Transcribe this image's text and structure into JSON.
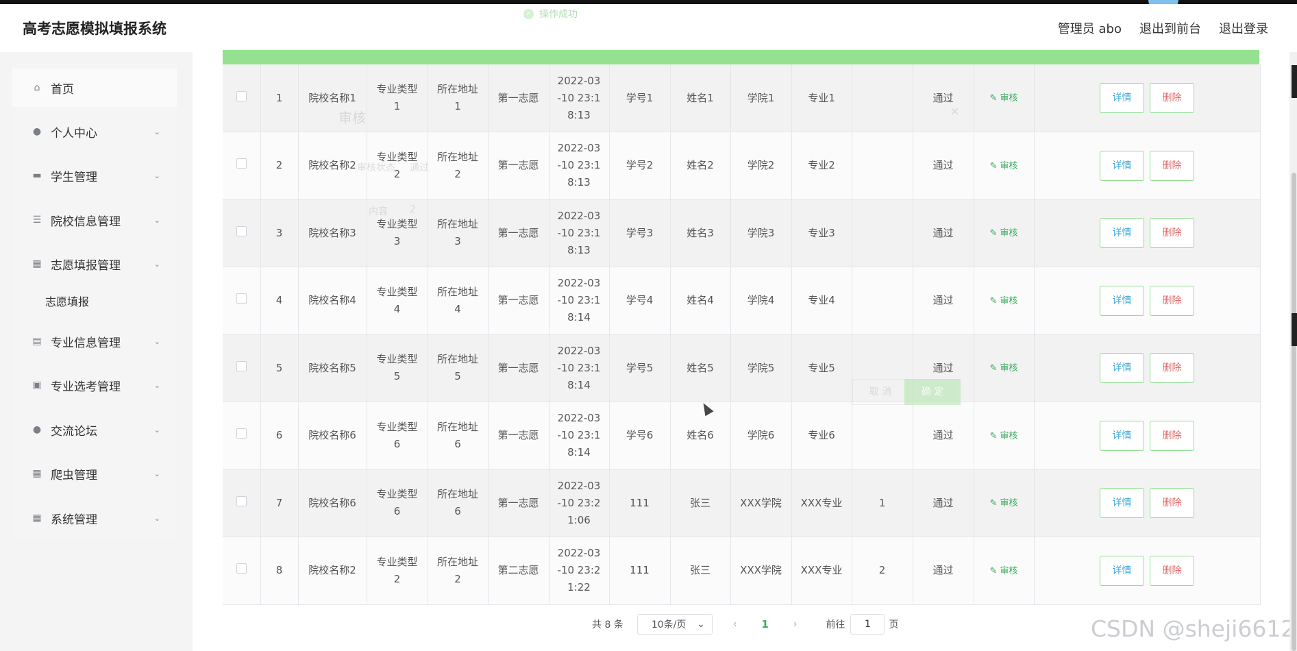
{
  "header": {
    "title": "高考志愿模拟填报系统",
    "user": "管理员 abo",
    "to_front": "退出到前台",
    "logout": "退出登录"
  },
  "toast": {
    "text": "操作成功"
  },
  "sidebar": {
    "items": [
      {
        "label": "首页",
        "icon": "home-icon"
      },
      {
        "label": "个人中心",
        "icon": "user-icon"
      },
      {
        "label": "学生管理",
        "icon": "folder-icon"
      },
      {
        "label": "院校信息管理",
        "icon": "list-icon"
      },
      {
        "label": "志愿填报管理",
        "icon": "grid-icon"
      },
      {
        "label": "专业信息管理",
        "icon": "clipboard-icon"
      },
      {
        "label": "专业选考管理",
        "icon": "clipboard-x-icon"
      },
      {
        "label": "交流论坛",
        "icon": "user-icon"
      },
      {
        "label": "爬虫管理",
        "icon": "grid-icon"
      },
      {
        "label": "系统管理",
        "icon": "grid-icon"
      }
    ],
    "sub_item": "志愿填报"
  },
  "table": {
    "rows": [
      {
        "no": "1",
        "school": "院校名称1",
        "type": "专业类型\n1",
        "addr": "所在地址\n1",
        "choice": "第一志愿",
        "time": "2022-03\n-10 23:1\n8:13",
        "sid": "学号1",
        "name": "姓名1",
        "college": "学院1",
        "major": "专业1",
        "extra": "",
        "status": "通过"
      },
      {
        "no": "2",
        "school": "院校名称2",
        "type": "专业类型\n2",
        "addr": "所在地址\n2",
        "choice": "第一志愿",
        "time": "2022-03\n-10 23:1\n8:13",
        "sid": "学号2",
        "name": "姓名2",
        "college": "学院2",
        "major": "专业2",
        "extra": "",
        "status": "通过"
      },
      {
        "no": "3",
        "school": "院校名称3",
        "type": "专业类型\n3",
        "addr": "所在地址\n3",
        "choice": "第一志愿",
        "time": "2022-03\n-10 23:1\n8:13",
        "sid": "学号3",
        "name": "姓名3",
        "college": "学院3",
        "major": "专业3",
        "extra": "",
        "status": "通过"
      },
      {
        "no": "4",
        "school": "院校名称4",
        "type": "专业类型\n4",
        "addr": "所在地址\n4",
        "choice": "第一志愿",
        "time": "2022-03\n-10 23:1\n8:14",
        "sid": "学号4",
        "name": "姓名4",
        "college": "学院4",
        "major": "专业4",
        "extra": "",
        "status": "通过"
      },
      {
        "no": "5",
        "school": "院校名称5",
        "type": "专业类型\n5",
        "addr": "所在地址\n5",
        "choice": "第一志愿",
        "time": "2022-03\n-10 23:1\n8:14",
        "sid": "学号5",
        "name": "姓名5",
        "college": "学院5",
        "major": "专业5",
        "extra": "",
        "status": "通过"
      },
      {
        "no": "6",
        "school": "院校名称6",
        "type": "专业类型\n6",
        "addr": "所在地址\n6",
        "choice": "第一志愿",
        "time": "2022-03\n-10 23:1\n8:14",
        "sid": "学号6",
        "name": "姓名6",
        "college": "学院6",
        "major": "专业6",
        "extra": "",
        "status": "通过"
      },
      {
        "no": "7",
        "school": "院校名称6",
        "type": "专业类型\n6",
        "addr": "所在地址\n6",
        "choice": "第一志愿",
        "time": "2022-03\n-10 23:2\n1:06",
        "sid": "111",
        "name": "张三",
        "college": "XXX学院",
        "major": "XXX专业",
        "extra": "1",
        "status": "通过"
      },
      {
        "no": "8",
        "school": "院校名称2",
        "type": "专业类型\n2",
        "addr": "所在地址\n2",
        "choice": "第二志愿",
        "time": "2022-03\n-10 23:2\n1:22",
        "sid": "111",
        "name": "张三",
        "college": "XXX学院",
        "major": "XXX专业",
        "extra": "2",
        "status": "通过"
      }
    ],
    "audit_label": "审核",
    "detail_label": "详情",
    "delete_label": "删除"
  },
  "ghost_dialog": {
    "title": "审核",
    "close": "×",
    "status_label": "审核状态",
    "status_value": "通过",
    "content_label": "内容",
    "content_value": "2",
    "cancel": "取 消",
    "ok": "确 定"
  },
  "pagination": {
    "total": "共 8 条",
    "page_size": "10条/页",
    "prev": "‹",
    "current": "1",
    "next": "›",
    "goto": "前往",
    "page_input": "1",
    "page_unit": "页"
  },
  "watermark": "CSDN @sheji6612"
}
